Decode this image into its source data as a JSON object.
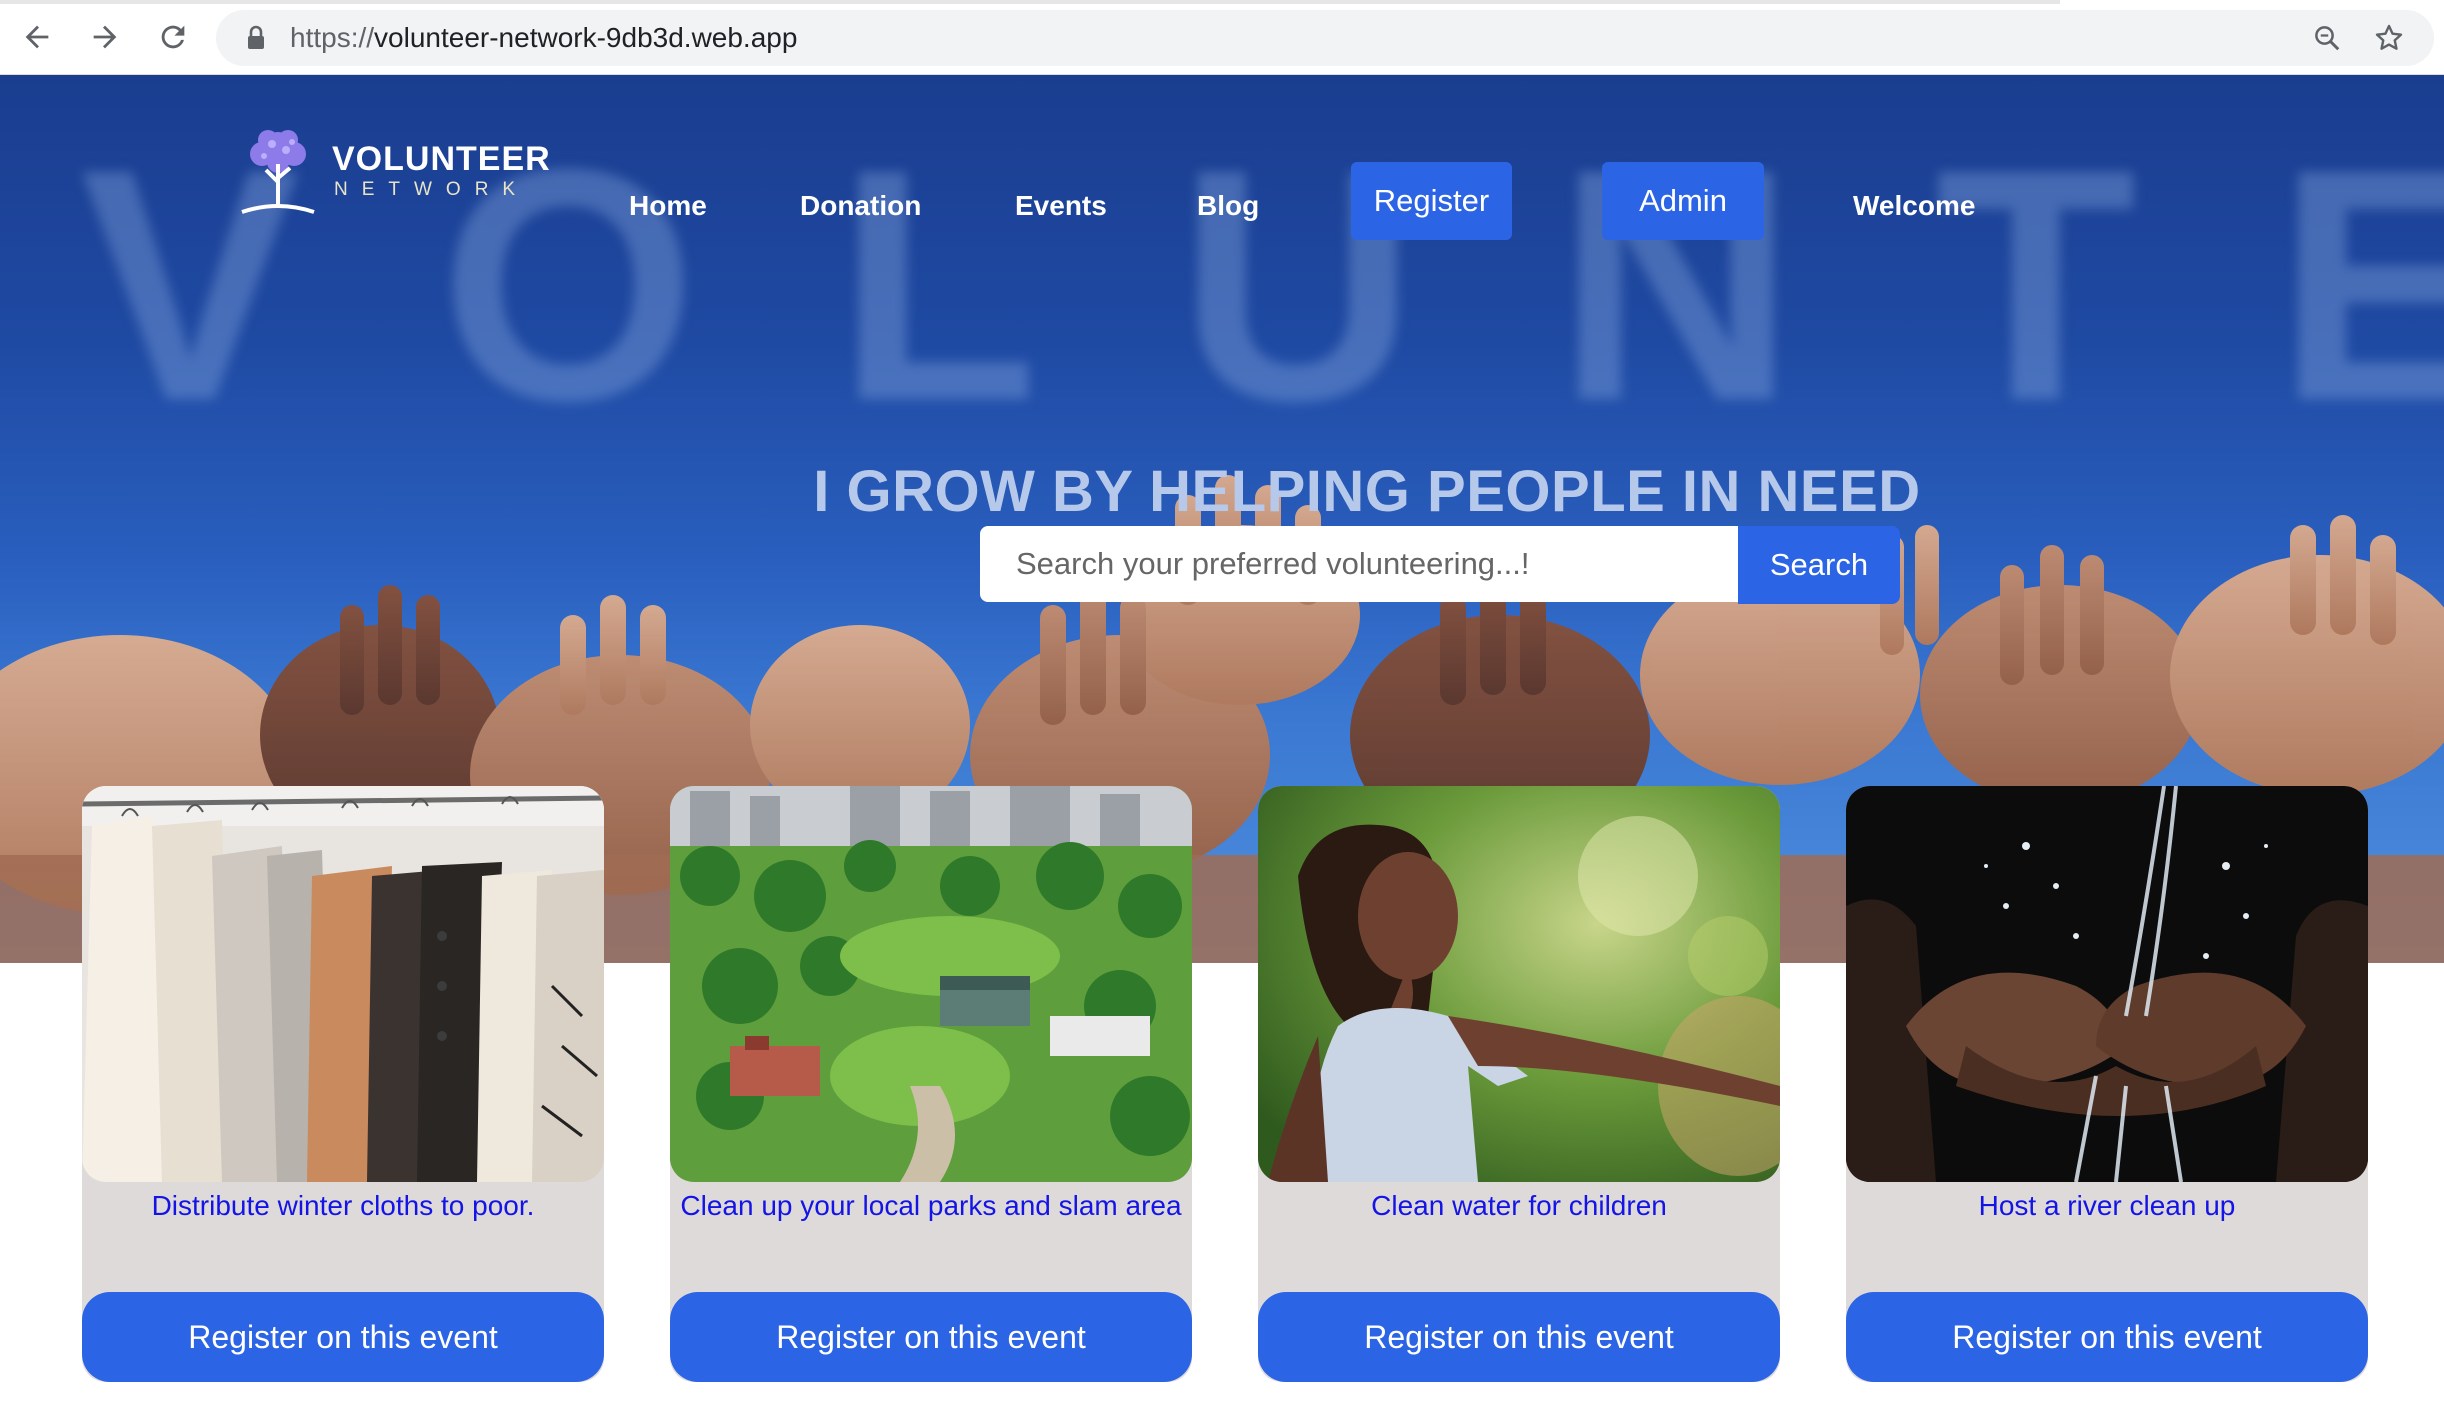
{
  "browser": {
    "url_scheme": "https://",
    "url_host": "volunteer-network-9db3d.web.app"
  },
  "logo": {
    "title": "VOLUNTEER",
    "subtitle": "NETWORK"
  },
  "hero": {
    "watermark": "VOLUNTEER",
    "heading": "I GROW BY HELPING PEOPLE IN NEED"
  },
  "nav": {
    "home": "Home",
    "donation": "Donation",
    "events": "Events",
    "blog": "Blog",
    "register": "Register",
    "admin": "Admin",
    "welcome": "Welcome"
  },
  "search": {
    "placeholder": "Search your preferred volunteering...!",
    "button_label": "Search"
  },
  "events": [
    {
      "title": "Distribute winter cloths to poor.",
      "button_label": "Register on this event"
    },
    {
      "title": "Clean up your local parks and slam area",
      "button_label": "Register on this event"
    },
    {
      "title": "Clean water for children",
      "button_label": "Register on this event"
    },
    {
      "title": "Host a river clean up",
      "button_label": "Register on this event"
    }
  ],
  "colors": {
    "primary_button": "#2c64e6",
    "card_background": "#dedad9",
    "card_title": "#1414e6",
    "hero_heading": "#b7c9ea"
  },
  "icons": {
    "back": "back-arrow-icon",
    "forward": "forward-arrow-icon",
    "reload": "reload-icon",
    "lock": "lock-icon",
    "zoom": "zoom-icon",
    "bookmark": "star-icon",
    "logo": "tree-logo-icon"
  }
}
